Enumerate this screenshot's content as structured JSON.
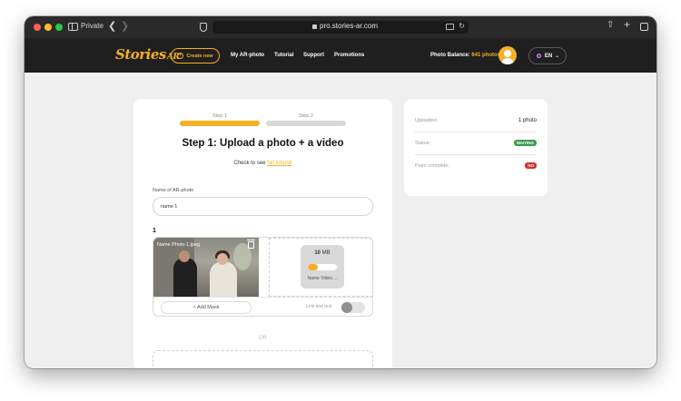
{
  "browser": {
    "private_label": "Private",
    "url": "pro.stories-ar.com"
  },
  "header": {
    "logo_text": "Stories",
    "logo_suffix": "AR",
    "create_button": "Create new",
    "nav": [
      "My AR-photo",
      "Tutorial",
      "Support",
      "Promotions"
    ],
    "balance_label": "Photo Balance:",
    "balance_value": "641 photos",
    "language": "EN"
  },
  "upload": {
    "steps": [
      "Step 1",
      "Step 2"
    ],
    "title": "Step 1: Upload a photo + a video",
    "tutorial_prefix": "Check to see",
    "tutorial_link": "full tutorial",
    "name_label": "Name of AR-photo",
    "name_value": "name 1",
    "item_index": "1",
    "photo_name": "Name Photo 1.jpeg",
    "video_size_number": "10",
    "video_size_unit": "MB",
    "video_progress": 0.35,
    "video_name": "Name Video....",
    "add_mask": "+ Add Mask",
    "link_text": "Link and text",
    "or_text": "OR"
  },
  "summary": {
    "uploaded_label": "Uploaded:",
    "uploaded_value": "1 photo",
    "status_label": "Status:",
    "status_value": "WAITING",
    "pairs_label": "Pairs complete:",
    "pairs_value": "NO"
  },
  "colors": {
    "accent": "#f5b027",
    "header_bg": "#1f1f1f",
    "status_green": "#3a9a4c",
    "status_red": "#d0312d"
  }
}
